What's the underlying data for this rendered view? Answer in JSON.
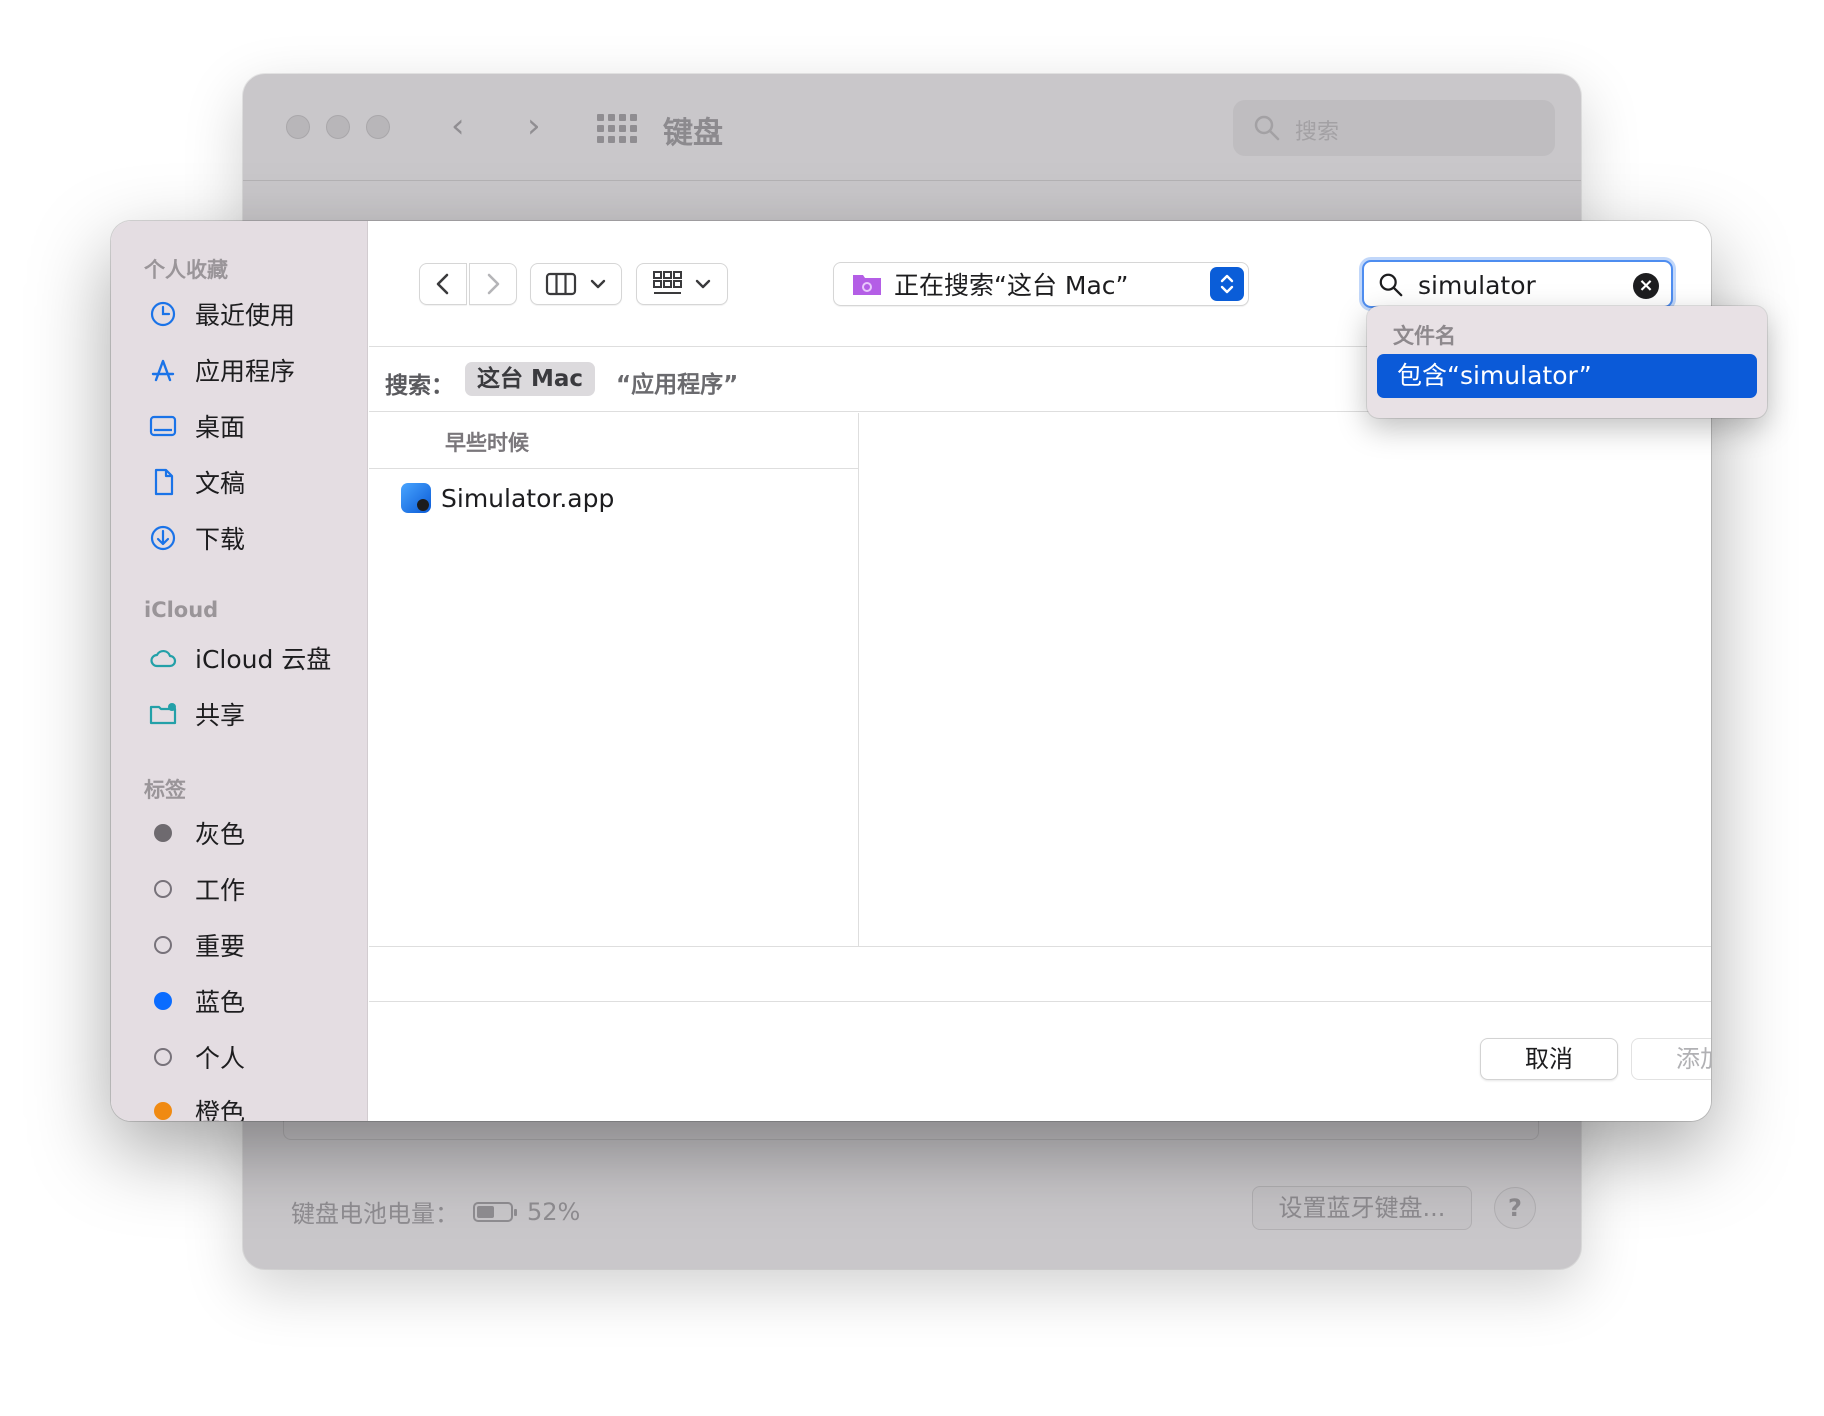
{
  "background_window": {
    "title": "键盘",
    "search_placeholder": "搜索",
    "battery_label": "键盘电池电量：",
    "battery_percent": "52%",
    "battery_level": 0.52,
    "bluetooth_button": "设置蓝牙键盘...",
    "help_button": "?"
  },
  "dialog": {
    "sidebar": {
      "favorites_header": "个人收藏",
      "favorites": [
        {
          "label": "最近使用",
          "icon": "clock-icon"
        },
        {
          "label": "应用程序",
          "icon": "apps-icon"
        },
        {
          "label": "桌面",
          "icon": "desktop-icon"
        },
        {
          "label": "文稿",
          "icon": "document-icon"
        },
        {
          "label": "下载",
          "icon": "download-icon"
        }
      ],
      "icloud_header": "iCloud",
      "icloud": [
        {
          "label": "iCloud 云盘",
          "icon": "cloud-icon"
        },
        {
          "label": "共享",
          "icon": "shared-folder-icon"
        }
      ],
      "tags_header": "标签",
      "tags": [
        {
          "label": "灰色",
          "color": "#6e6a6f",
          "filled": true
        },
        {
          "label": "工作",
          "color": "",
          "filled": false
        },
        {
          "label": "重要",
          "color": "",
          "filled": false
        },
        {
          "label": "蓝色",
          "color": "#0a6cff",
          "filled": true
        },
        {
          "label": "个人",
          "color": "",
          "filled": false
        },
        {
          "label": "橙色",
          "color": "#f08a12",
          "filled": true
        }
      ]
    },
    "location_label": "正在搜索“这台 Mac”",
    "search_value": "simulator",
    "scope": {
      "label": "搜索：",
      "this_mac": "这台 Mac",
      "applications": "“应用程序”"
    },
    "list_header": "早些时候",
    "files": [
      {
        "name": "Simulator.app"
      }
    ],
    "cancel_button": "取消",
    "add_button": "添加",
    "suggestions": {
      "header": "文件名",
      "item": "包含“simulator”"
    },
    "accent_color": "#0b5ad8"
  }
}
